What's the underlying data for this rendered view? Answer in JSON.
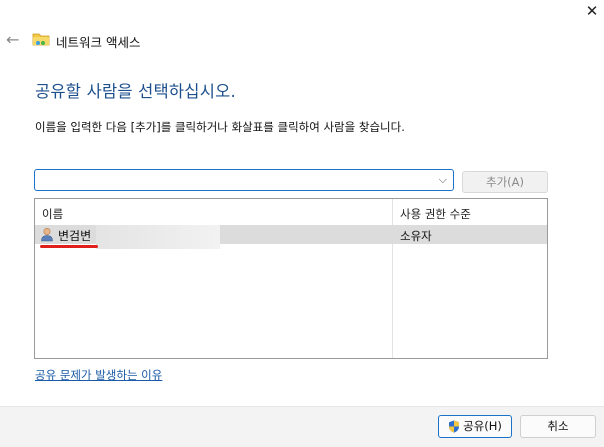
{
  "window": {
    "title": "네트워크 액세스",
    "close_glyph": "✕",
    "back_glyph": "←",
    "close_icon": "close-icon",
    "back_icon": "back-arrow-icon",
    "title_icon": "network-folder-icon"
  },
  "main": {
    "heading": "공유할 사람을 선택하십시오.",
    "instruction": "이름을 입력한 다음 [추가]를 클릭하거나 화살표를 클릭하여 사람을 찾습니다.",
    "name_input_value": "",
    "dropdown_icon": "chevron-down-icon",
    "add_button_label": "추가(A)"
  },
  "table": {
    "columns": [
      "이름",
      "사용 권한 수준"
    ],
    "rows": [
      {
        "name": "변검변",
        "permission": "소유자",
        "icon": "user-icon",
        "selected": true
      }
    ]
  },
  "links": {
    "help": "공유 문제가 발생하는 이유"
  },
  "footer": {
    "share_button_label": "공유(H)",
    "share_icon": "uac-shield-icon",
    "cancel_button_label": "취소"
  },
  "colors": {
    "heading": "#1c4f8c",
    "link": "#1a5aa6",
    "accent_border": "#1a73c8",
    "annotation_underline": "#e0201c"
  }
}
